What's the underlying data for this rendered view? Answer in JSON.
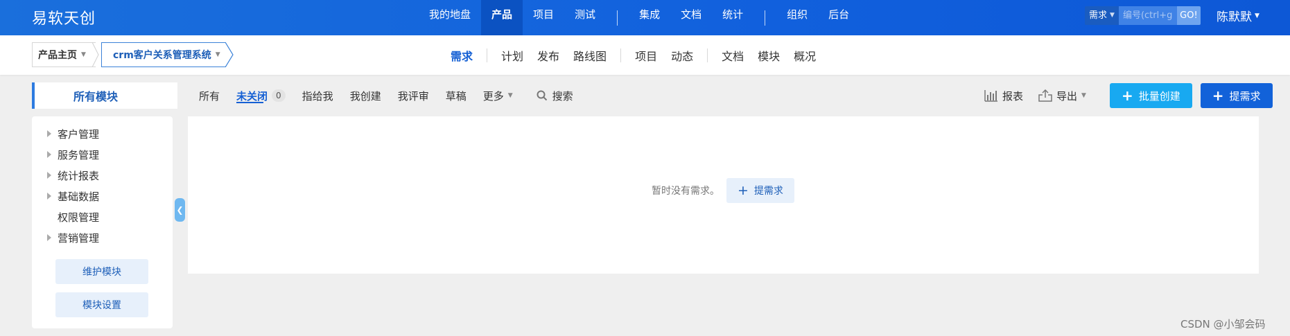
{
  "brand": "易软天创",
  "main_nav": [
    {
      "label": "我的地盘",
      "active": false
    },
    {
      "label": "产品",
      "active": true
    },
    {
      "label": "项目",
      "active": false
    },
    {
      "label": "测试",
      "active": false
    },
    {
      "label": "集成",
      "active": false
    },
    {
      "label": "文档",
      "active": false
    },
    {
      "label": "统计",
      "active": false
    },
    {
      "label": "组织",
      "active": false
    },
    {
      "label": "后台",
      "active": false
    }
  ],
  "search": {
    "type_label": "需求",
    "placeholder": "编号(ctrl+g)",
    "go_label": "GO!"
  },
  "user": {
    "name": "陈默默"
  },
  "breadcrumb": {
    "home": "产品主页",
    "product": "crm客户关系管理系统"
  },
  "sub_nav": [
    {
      "label": "需求",
      "active": true
    },
    {
      "label": "计划",
      "active": false
    },
    {
      "label": "发布",
      "active": false
    },
    {
      "label": "路线图",
      "active": false
    },
    {
      "label": "项目",
      "active": false
    },
    {
      "label": "动态",
      "active": false
    },
    {
      "label": "文档",
      "active": false
    },
    {
      "label": "模块",
      "active": false
    },
    {
      "label": "概况",
      "active": false
    }
  ],
  "module_title": "所有模块",
  "tabs": {
    "all": "所有",
    "unclosed": "未关闭",
    "unclosed_count": "0",
    "assigned": "指给我",
    "created": "我创建",
    "reviewing": "我评审",
    "draft": "草稿",
    "more": "更多",
    "search": "搜索"
  },
  "actions": {
    "report": "报表",
    "export": "导出",
    "batch_create": "批量创建",
    "create": "提需求"
  },
  "tree": [
    {
      "label": "客户管理",
      "has_children": true
    },
    {
      "label": "服务管理",
      "has_children": true
    },
    {
      "label": "统计报表",
      "has_children": true
    },
    {
      "label": "基础数据",
      "has_children": true
    },
    {
      "label": "权限管理",
      "has_children": false
    },
    {
      "label": "营销管理",
      "has_children": true
    }
  ],
  "sidebar_buttons": {
    "maintain": "维护模块",
    "settings": "模块设置"
  },
  "empty": {
    "message": "暂时没有需求。",
    "button": "提需求"
  },
  "watermark": "CSDN @小邹会码",
  "colors": {
    "topbar": "#1160dd",
    "primary": "#1262d9",
    "light_button": "#18a9f1",
    "background": "#efefef"
  }
}
